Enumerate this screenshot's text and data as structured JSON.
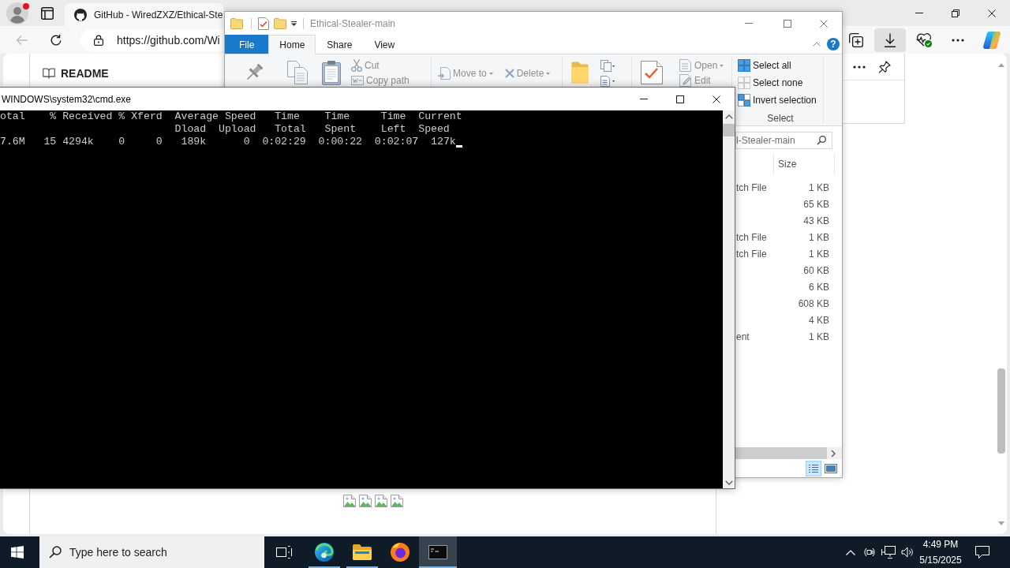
{
  "browser": {
    "tab": {
      "title": "GitHub - WiredZXZ/Ethical-Ste"
    },
    "back_button": {
      "disabled": true
    },
    "address": "https://github.com/Wi",
    "toolbar_buttons": [
      {
        "kind": "collections",
        "selected": false
      },
      {
        "kind": "downloads",
        "selected": true
      },
      {
        "kind": "health",
        "selected": false
      },
      {
        "kind": "more",
        "selected": false
      },
      {
        "kind": "copilot",
        "selected": false
      }
    ],
    "readme": {
      "title": "README",
      "images": [
        {
          "broken": true
        },
        {
          "broken": true
        },
        {
          "broken": true
        },
        {
          "broken": true
        }
      ]
    }
  },
  "explorer": {
    "title": "Ethical-Stealer-main",
    "help_label": "?",
    "ribbon_tabs": [
      {
        "label": "File",
        "kind": "file",
        "selected": false
      },
      {
        "label": "Home",
        "kind": "tab",
        "selected": true
      },
      {
        "label": "Share",
        "kind": "tab",
        "selected": false
      },
      {
        "label": "View",
        "kind": "tab",
        "selected": false
      }
    ],
    "ribbon_groups": [
      {
        "kind": "clipboard",
        "buttons": [
          {
            "kind": "cut",
            "label": "Cut",
            "disabled": true
          },
          {
            "kind": "copy_path",
            "label": "Copy path",
            "disabled": true
          }
        ]
      },
      {
        "kind": "organize",
        "buttons": [
          {
            "kind": "move_to",
            "label": "Move to",
            "disabled": true
          },
          {
            "kind": "delete",
            "label": "Delete",
            "disabled": true
          }
        ]
      },
      {
        "kind": "new"
      },
      {
        "kind": "open",
        "buttons": [
          {
            "kind": "open",
            "label": "Open",
            "disabled": true
          },
          {
            "kind": "edit",
            "label": "Edit",
            "disabled": true
          }
        ]
      },
      {
        "kind": "select",
        "label": "Select",
        "buttons": [
          {
            "kind": "select_all",
            "label": "Select all",
            "disabled": false
          },
          {
            "kind": "select_none",
            "label": "Select none",
            "disabled": false
          },
          {
            "kind": "invert_selection",
            "label": "Invert selection",
            "disabled": false
          }
        ]
      }
    ],
    "search": {
      "placeholder": "l-Stealer-main"
    },
    "columns": [
      {
        "label": "Size"
      }
    ],
    "files": [
      {
        "type": "tch File",
        "size": "1 KB"
      },
      {
        "size": "65 KB"
      },
      {
        "size": "43 KB"
      },
      {
        "type": "tch File",
        "size": "1 KB"
      },
      {
        "type": "tch File",
        "size": "1 KB"
      },
      {
        "size": "60 KB"
      },
      {
        "size": "6 KB"
      },
      {
        "size": "608 KB"
      },
      {
        "size": "4 KB"
      },
      {
        "type": "ent",
        "size": "1 KB"
      }
    ],
    "view_buttons": [
      {
        "kind": "details",
        "selected": true
      },
      {
        "kind": "large_icons",
        "selected": false
      }
    ]
  },
  "cmd": {
    "title": "WINDOWS\\system32\\cmd.exe",
    "header": [
      "otal    % Received % Xferd  Average Speed   Time    Time     Time  Current",
      "Dload  Upload   Total   Spent    Left  Speed"
    ],
    "progress": "7.6M   15 4294k    0     0   189k      0  0:02:29  0:00:22  0:02:07  127k",
    "cursor": true
  },
  "taskbar": {
    "search_placeholder": "Type here to search",
    "apps": [
      {
        "kind": "edge",
        "running": true,
        "selected": false
      },
      {
        "kind": "explorer",
        "running": true,
        "selected": false
      },
      {
        "kind": "firefox",
        "running": false,
        "selected": false
      },
      {
        "kind": "cmd",
        "running": true,
        "selected": true
      }
    ],
    "clock": {
      "time": "4:49 PM",
      "date": "5/15/2025"
    }
  }
}
